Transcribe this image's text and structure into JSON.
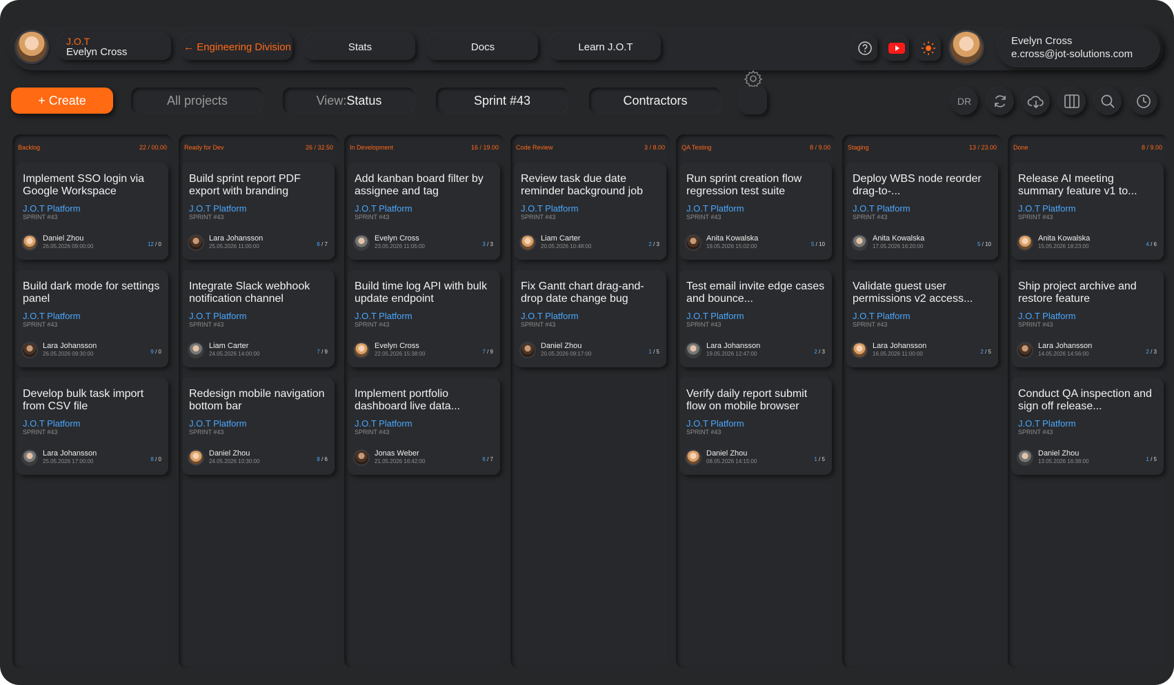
{
  "header": {
    "company": "J.O.T",
    "current_user_name": "Evelyn Cross",
    "division_link": "← Engineering Division",
    "nav": [
      "Stats",
      "Docs",
      "Learn J.O.T"
    ],
    "user_name": "Evelyn Cross",
    "user_email": "e.cross@jot-solutions.com"
  },
  "toolbar": {
    "create_label": "+ Create",
    "projects_label": "All projects",
    "view_prefix": "View: ",
    "view_value": "Status",
    "sprint_label": "Sprint #43",
    "contractors_label": "Contractors",
    "initials": "DR"
  },
  "columns": [
    {
      "title": "Backlog",
      "count": "22 / 00.00",
      "cards": [
        {
          "title": "Implement SSO login via Google Workspace",
          "project": "J.O.T Platform",
          "sprint": "SPRINT #43",
          "assignee": "Daniel Zhou",
          "date": "26.05.2026 09:00:00",
          "done": "12",
          "total": "0"
        },
        {
          "title": "Build dark mode for settings panel",
          "project": "J.O.T Platform",
          "sprint": "SPRINT #43",
          "assignee": "Lara Johansson",
          "date": "26.05.2026 09:30:00",
          "done": "9",
          "total": "0"
        },
        {
          "title": "Develop bulk task import from CSV file",
          "project": "J.O.T Platform",
          "sprint": "SPRINT #43",
          "assignee": "Lara Johansson",
          "date": "25.05.2026 17:00:00",
          "done": "8",
          "total": "0"
        }
      ]
    },
    {
      "title": "Ready for Dev",
      "count": "26 / 32.50",
      "cards": [
        {
          "title": "Build sprint report PDF export with branding",
          "project": "J.O.T Platform",
          "sprint": "SPRINT #43",
          "assignee": "Lara Johansson",
          "date": "25.05.2026 11:00:00",
          "done": "6",
          "total": "7"
        },
        {
          "title": "Integrate Slack webhook notification channel",
          "project": "J.O.T Platform",
          "sprint": "SPRINT #43",
          "assignee": "Liam Carter",
          "date": "24.05.2026 14:00:00",
          "done": "7",
          "total": "9"
        },
        {
          "title": "Redesign mobile navigation bottom bar",
          "project": "J.O.T Platform",
          "sprint": "SPRINT #43",
          "assignee": "Daniel Zhou",
          "date": "24.05.2026 10:30:00",
          "done": "8",
          "total": "6"
        }
      ]
    },
    {
      "title": "In Development",
      "count": "16 / 19.00",
      "cards": [
        {
          "title": "Add kanban board filter by assignee and tag",
          "project": "J.O.T Platform",
          "sprint": "SPRINT #43",
          "assignee": "Evelyn Cross",
          "date": "23.05.2026 11:05:00",
          "done": "3",
          "total": "3"
        },
        {
          "title": "Build time log API with bulk update endpoint",
          "project": "J.O.T Platform",
          "sprint": "SPRINT #43",
          "assignee": "Evelyn Cross",
          "date": "22.05.2026 15:38:00",
          "done": "7",
          "total": "9"
        },
        {
          "title": "Implement portfolio dashboard live data...",
          "project": "J.O.T Platform",
          "sprint": "SPRINT #43",
          "assignee": "Jonas Weber",
          "date": "21.05.2026 16:42:00",
          "done": "6",
          "total": "7"
        }
      ]
    },
    {
      "title": "Code Review",
      "count": "3 / 8.00",
      "cards": [
        {
          "title": "Review task due date reminder background job",
          "project": "J.O.T Platform",
          "sprint": "SPRINT #43",
          "assignee": "Liam Carter",
          "date": "20.05.2026 10:48:00",
          "done": "2",
          "total": "3"
        },
        {
          "title": "Fix Gantt chart drag-and-drop date change bug",
          "project": "J.O.T Platform",
          "sprint": "SPRINT #43",
          "assignee": "Daniel Zhou",
          "date": "20.05.2026 09:17:00",
          "done": "1",
          "total": "5"
        }
      ]
    },
    {
      "title": "QA Testing",
      "count": "8 / 9.00",
      "cards": [
        {
          "title": "Run sprint creation flow regression test suite",
          "project": "J.O.T Platform",
          "sprint": "SPRINT #43",
          "assignee": "Anita Kowalska",
          "date": "19.05.2026 15:02:00",
          "done": "5",
          "total": "10"
        },
        {
          "title": "Test email invite edge cases and bounce...",
          "project": "J.O.T Platform",
          "sprint": "SPRINT #43",
          "assignee": "Lara Johansson",
          "date": "19.05.2026 12:47:00",
          "done": "2",
          "total": "3"
        },
        {
          "title": "Verify daily report submit flow on mobile browser",
          "project": "J.O.T Platform",
          "sprint": "SPRINT #43",
          "assignee": "Daniel Zhou",
          "date": "08.05.2026 14:15:00",
          "done": "1",
          "total": "5"
        }
      ]
    },
    {
      "title": "Staging",
      "count": "13 / 23.00",
      "cards": [
        {
          "title": "Deploy WBS node reorder drag-to-...",
          "project": "J.O.T Platform",
          "sprint": "SPRINT #43",
          "assignee": "Anita Kowalska",
          "date": "17.05.2026 16:20:00",
          "done": "5",
          "total": "10"
        },
        {
          "title": "Validate guest user permissions v2 access...",
          "project": "J.O.T Platform",
          "sprint": "SPRINT #43",
          "assignee": "Lara Johansson",
          "date": "16.05.2026 11:00:00",
          "done": "2",
          "total": "5"
        }
      ]
    },
    {
      "title": "Done",
      "count": "8 / 9.00",
      "cards": [
        {
          "title": "Release AI meeting summary feature v1 to...",
          "project": "J.O.T Platform",
          "sprint": "SPRINT #43",
          "assignee": "Anita Kowalska",
          "date": "15.05.2026 18:23:00",
          "done": "4",
          "total": "6"
        },
        {
          "title": "Ship project archive and restore feature",
          "project": "J.O.T Platform",
          "sprint": "SPRINT #43",
          "assignee": "Lara Johansson",
          "date": "14.05.2026 14:56:00",
          "done": "2",
          "total": "3"
        },
        {
          "title": "Conduct QA inspection and sign off release...",
          "project": "J.O.T Platform",
          "sprint": "SPRINT #43",
          "assignee": "Daniel Zhou",
          "date": "13.05.2026 16:38:00",
          "done": "1",
          "total": "5"
        }
      ]
    }
  ],
  "colors": {
    "accent": "#ff6a13",
    "link": "#4aa8ff",
    "bg": "#262729"
  }
}
